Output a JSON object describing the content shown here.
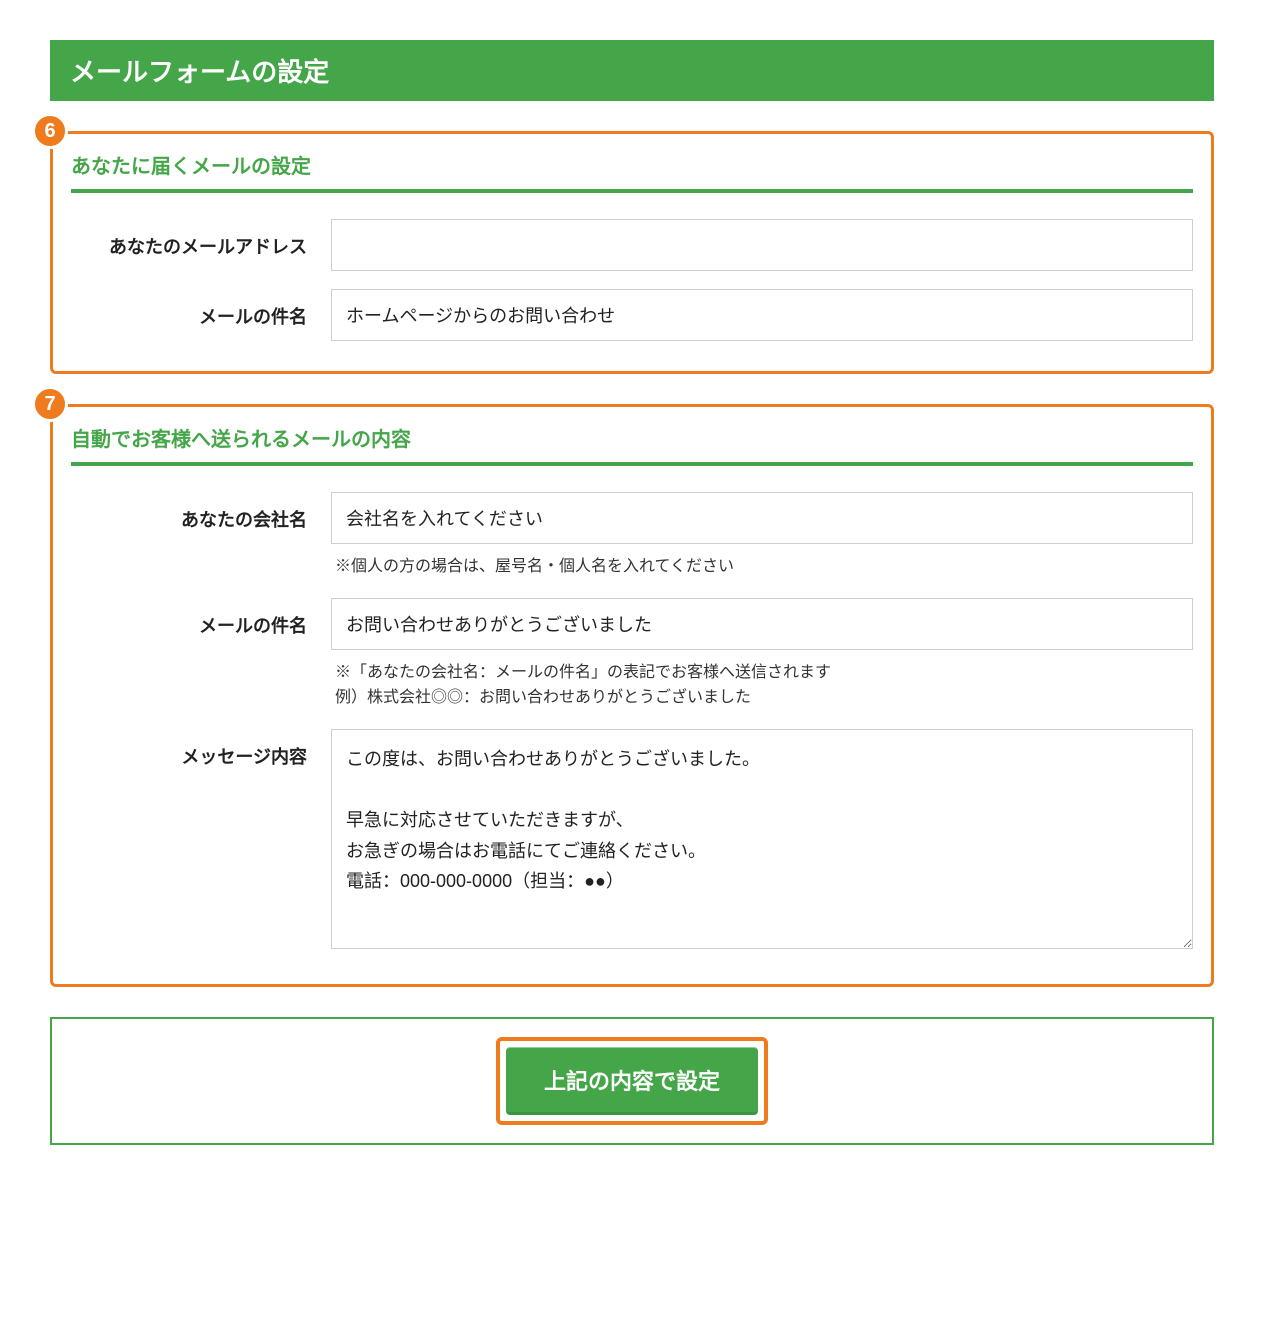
{
  "title": "メールフォームの設定",
  "steps": {
    "s6": "6",
    "s7": "7"
  },
  "section1": {
    "heading": "あなたに届くメールの設定",
    "row_email_label": "あなたのメールアドレス",
    "row_email_value": "",
    "row_subject_label": "メールの件名",
    "row_subject_value": "ホームページからのお問い合わせ"
  },
  "section2": {
    "heading": "自動でお客様へ送られるメールの内容",
    "row_company_label": "あなたの会社名",
    "row_company_value": "会社名を入れてください",
    "row_company_hint": "※個人の方の場合は、屋号名・個人名を入れてください",
    "row_subject_label": "メールの件名",
    "row_subject_value": "お問い合わせありがとうございました",
    "row_subject_hint1": "※「あなたの会社名：メールの件名」の表記でお客様へ送信されます",
    "row_subject_hint2": "例）株式会社◎◎：お問い合わせありがとうございました",
    "row_message_label": "メッセージ内容",
    "row_message_value": "この度は、お問い合わせありがとうございました。\n\n早急に対応させていただきますが、\nお急ぎの場合はお電話にてご連絡ください。\n電話：000-000-0000（担当：●●）"
  },
  "submit": {
    "label": "上記の内容で設定"
  }
}
